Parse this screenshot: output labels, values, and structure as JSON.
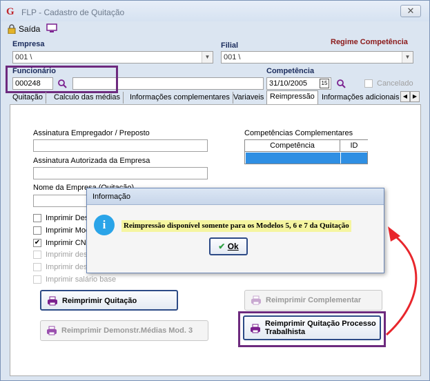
{
  "window": {
    "title": "FLP - Cadastro de Quitação",
    "close": "✕"
  },
  "toolbar": {
    "exit_label": "Saída"
  },
  "header": {
    "empresa_label": "Empresa",
    "empresa_value": "001 \\",
    "filial_label": "Filial",
    "filial_value": "001 \\",
    "regime_label": "Regime Competência",
    "funcionario_label": "Funcionário",
    "funcionario_value": "000248",
    "funcionario_name": "",
    "competencia_label": "Competência",
    "competencia_value": "31/10/2005",
    "cancelado_label": "Cancelado"
  },
  "tabs": [
    {
      "label": "Quitação"
    },
    {
      "label": "Calculo das médias"
    },
    {
      "label": "Informações complementares"
    },
    {
      "label": "Variaveis"
    },
    {
      "label": "Reimpressão"
    },
    {
      "label": "Informações adicionais"
    }
  ],
  "form": {
    "assinatura_empregador_label": "Assinatura Empregador / Preposto",
    "assinatura_autorizada_label": "Assinatura Autorizada da Empresa",
    "nome_empresa_label": "Nome da Empresa (Quitação)",
    "competencias_label": "Competências Complementares",
    "grid_headers": [
      "Competência",
      "ID"
    ]
  },
  "checkboxes": [
    {
      "label": "Imprimir Descrição",
      "checked": false,
      "enabled": true
    },
    {
      "label": "Imprimir Modelo",
      "checked": false,
      "enabled": true
    },
    {
      "label": "Imprimir CNPJ",
      "checked": true,
      "enabled": true
    },
    {
      "label": "Imprimir descrição",
      "checked": false,
      "enabled": false
    },
    {
      "label": "Imprimir descrição",
      "checked": false,
      "enabled": false
    },
    {
      "label": "Imprimir descrição",
      "checked": false,
      "enabled": false
    },
    {
      "label": "Imprimir salário base",
      "checked": false,
      "enabled": false
    }
  ],
  "buttons": {
    "reimprimir_quitacao": "Reimprimir Quitação",
    "reimprimir_complementar": "Reimprimir Complementar",
    "reimprimir_demonstr": "Reimprimir Demonstr.Médias Mod. 3",
    "reimprimir_processo_1": "Reimprimir Quitação Processo",
    "reimprimir_processo_2": "Trabalhista"
  },
  "dialog": {
    "title": "Informação",
    "message": "Reimpressão disponível somente para os Modelos 5, 6 e 7 da Quitação",
    "ok_label": "Ok"
  },
  "colors": {
    "highlight": "#6d2a7e",
    "arrow": "#e8262c",
    "selection": "#2f8fe3"
  }
}
